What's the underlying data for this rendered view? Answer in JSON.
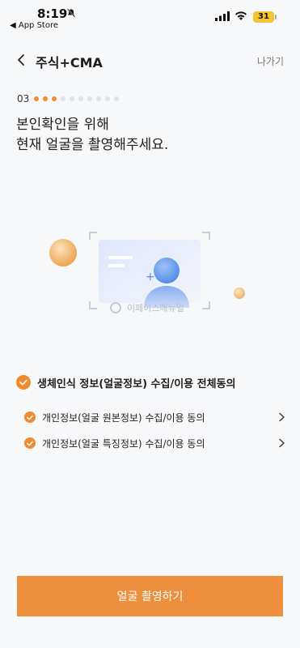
{
  "status": {
    "time": "8:19",
    "back_app": "◀ App Store",
    "battery": "31"
  },
  "header": {
    "title": "주식+CMA",
    "exit_label": "나가기"
  },
  "step": {
    "number": "03",
    "total": 10,
    "current": 3
  },
  "title_lines": [
    "본인확인을 위해",
    "현재 얼굴을 촬영해주세요."
  ],
  "illustration": {
    "watermark": "이페이스매뉴얼"
  },
  "consents": {
    "all_label": "생체인식 정보(얼굴정보) 수집/이용 전체동의",
    "items": [
      {
        "label": "개인정보(얼굴 원본정보) 수집/이용 동의"
      },
      {
        "label": "개인정보(얼굴 특징정보) 수집/이용 동의"
      }
    ]
  },
  "cta": {
    "label": "얼굴 촬영하기"
  },
  "colors": {
    "accent": "#ef8c2f",
    "cta_bg": "#ee8f3e",
    "background": "#f7f8fa"
  }
}
